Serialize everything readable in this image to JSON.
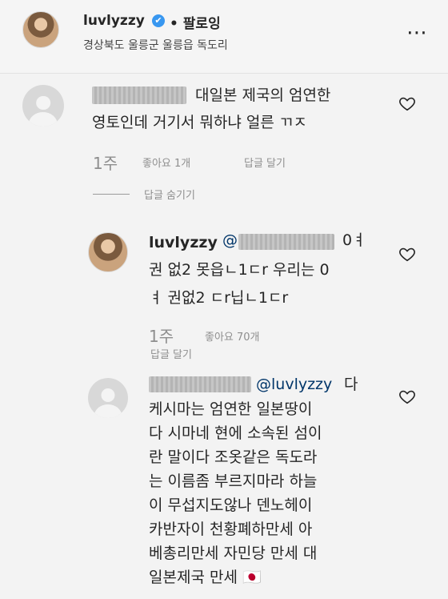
{
  "header": {
    "username": "luvlyzzy",
    "verified_mark": "✔",
    "follow_label": "• 팔로잉",
    "location": "경상북도 울릉군 울릉읍 독도리",
    "more_icon": "⋯"
  },
  "comments": [
    {
      "text_line1": "대일본 제국의 엄연한",
      "text_line2": "영토인데 거기서 뭐하냐 얼른 ㄲㅈ",
      "time": "1주",
      "likes": "좋아요 1개",
      "reply": "답글 달기",
      "hide_replies": "답글 숨기기"
    }
  ],
  "reply": {
    "username": "luvlyzzy",
    "mention_prefix": "@",
    "line1_end": "0ㅕ",
    "line2": "권 없2 못읍ㄴ1ㄷr 우리는 0",
    "line3": "ㅕ 권없2 ㄷr닙ㄴ1ㄷr",
    "time": "1주",
    "likes": "좋아요 70개",
    "reply": "답글 달기"
  },
  "reply2": {
    "mention": "@luvlyzzy",
    "line1_end": "다",
    "lines": [
      "케시마는 엄연한 일본땅이",
      "다 시마네 현에 소속된 섬이",
      "란 말이다 조옷같은 독도라",
      "는 이름좀 부르지마라 하늘",
      "이 무섭지도않나 덴노헤이",
      "카반자이 천황폐하만세 아",
      "베총리만세 자민당 만세 대",
      "일본제국 만세 🇯🇵"
    ]
  }
}
